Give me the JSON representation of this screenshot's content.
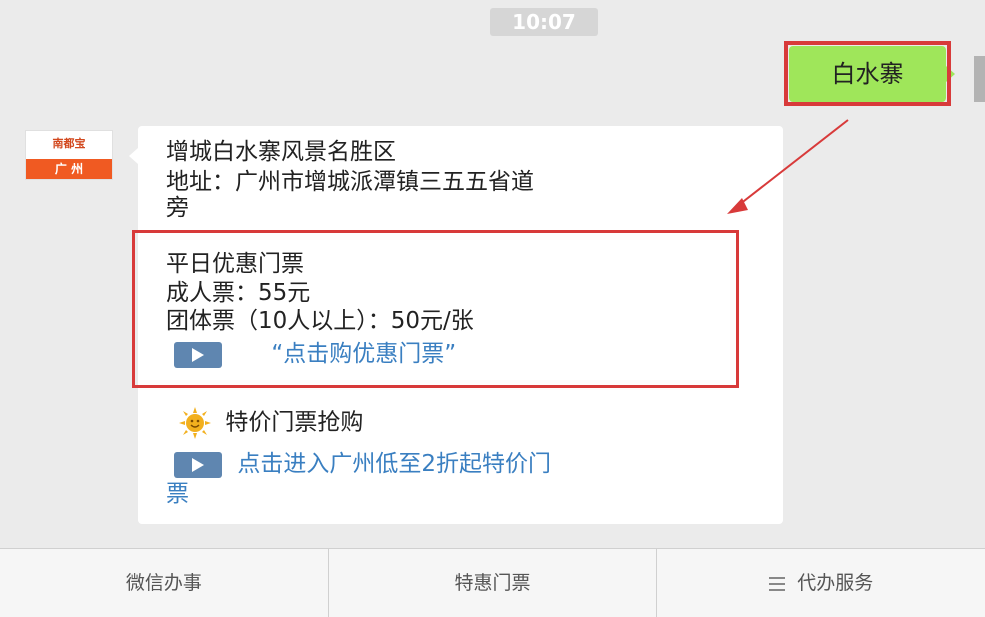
{
  "timestamp": "10:07",
  "sent_message": "白水寨",
  "account": {
    "logo_top": "南都宝",
    "logo_bottom": "广 州"
  },
  "message": {
    "title": "增城白水寨风景名胜区",
    "address_line1": "地址：广州市增城派潭镇三五五省道",
    "address_line2": "旁",
    "weekday_tickets": "平日优惠门票",
    "adult_ticket": "成人票：55元",
    "group_ticket": "团体票（10人以上）：50元/张",
    "buy_link": "“点击购优惠门票”",
    "special_heading": "特价门票抢购",
    "special_link_line1": "点击进入广州低至2折起特价门",
    "special_link_line2": "票"
  },
  "bottom_menu": [
    {
      "label": "微信办事"
    },
    {
      "label": "特惠门票"
    },
    {
      "label": "代办服务"
    }
  ],
  "colors": {
    "sent_bubble": "#9fe65a",
    "highlight": "#d83a3a",
    "link": "#3a7fc1"
  },
  "icons": [
    "play-icon",
    "sun-icon",
    "menu-icon"
  ]
}
